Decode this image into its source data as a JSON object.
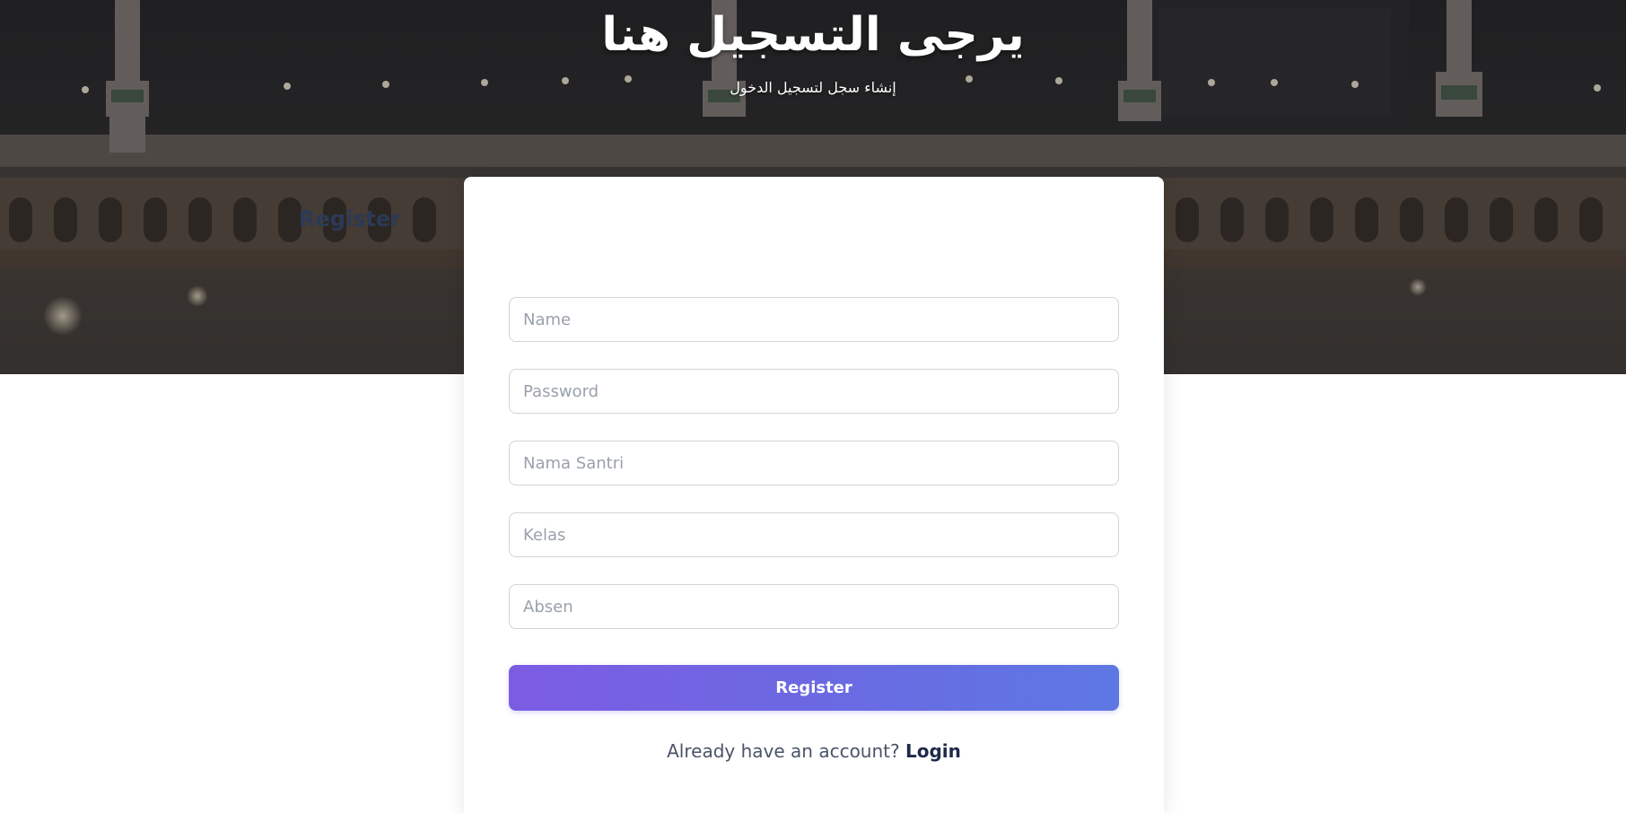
{
  "hero": {
    "title": "يرجى التسجيل هنا",
    "subtitle": "إنشاء سجل لتسجيل الدخول"
  },
  "form": {
    "title": "Register",
    "fields": {
      "name": {
        "placeholder": "Name",
        "value": ""
      },
      "password": {
        "placeholder": "Password",
        "value": ""
      },
      "nama_santri": {
        "placeholder": "Nama Santri",
        "value": ""
      },
      "kelas": {
        "placeholder": "Kelas",
        "value": ""
      },
      "absen": {
        "placeholder": "Absen",
        "value": ""
      }
    },
    "submit_label": "Register",
    "login_prompt": "Already have an account?",
    "login_link": "Login"
  },
  "colors": {
    "accent_start": "#7c5ce3",
    "accent_end": "#5d78e3",
    "heading": "#2c3a57",
    "text": "#4a5468"
  }
}
